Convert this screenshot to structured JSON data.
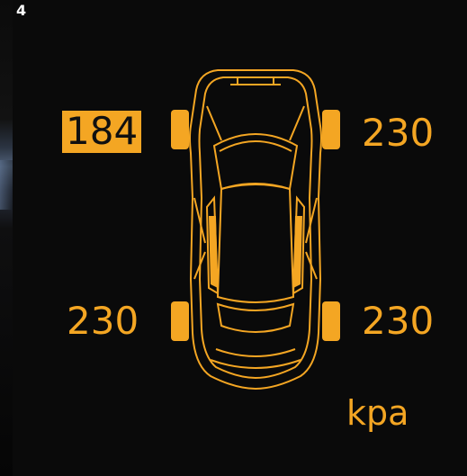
{
  "figure_number": "4",
  "tire_pressures": {
    "front_left": "184",
    "front_right": "230",
    "rear_left": "230",
    "rear_right": "230"
  },
  "alert_tire": "front_left",
  "unit": "kpa",
  "colors": {
    "display_background": "#0a0a0a",
    "accent": "#f4a623",
    "alert_text": "#101010"
  },
  "icons": {
    "car": "car-top-view-icon",
    "tires": [
      "front-left-tire-icon",
      "front-right-tire-icon",
      "rear-left-tire-icon",
      "rear-right-tire-icon"
    ]
  }
}
